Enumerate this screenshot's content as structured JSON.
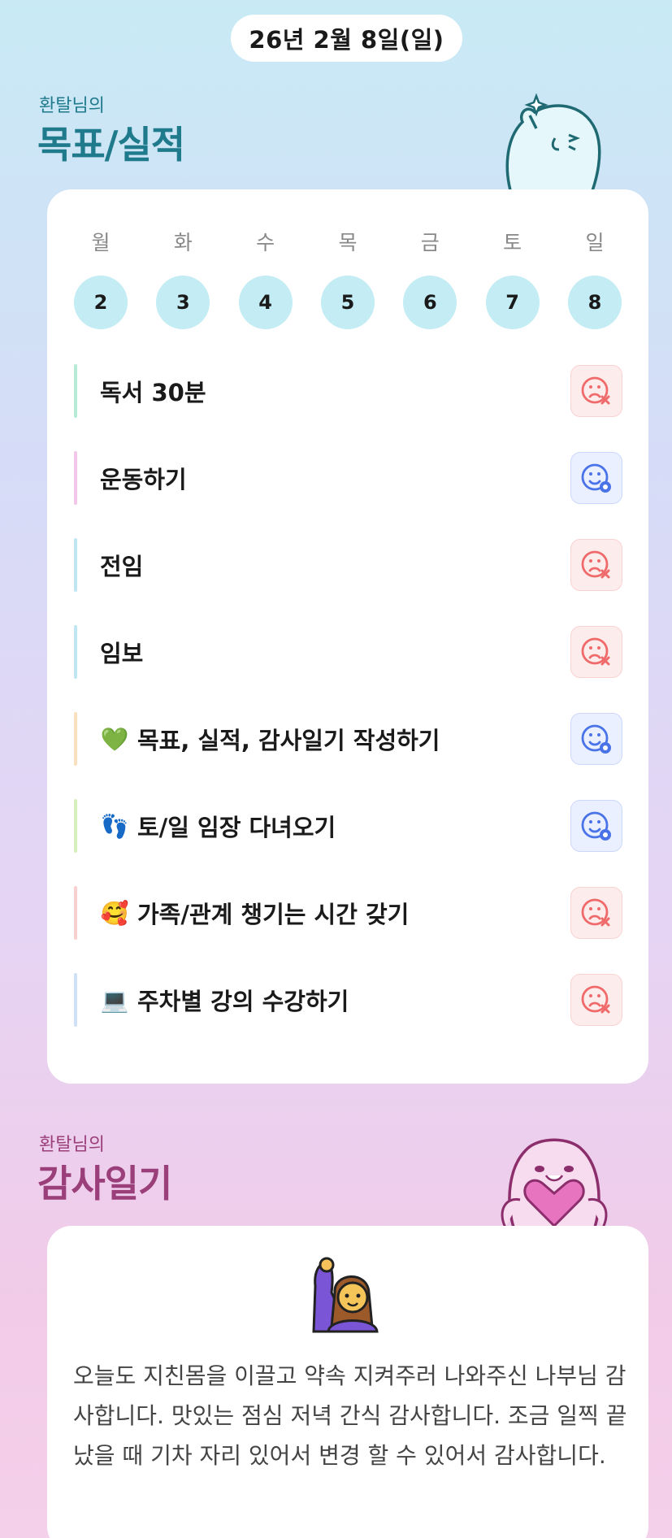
{
  "date": "26년 2월 8일(일)",
  "goals_section": {
    "owner": "환탈님의",
    "title": "목표/실적",
    "accent": "#1f7a8c"
  },
  "week": {
    "days": [
      {
        "dow": "월",
        "num": "2"
      },
      {
        "dow": "화",
        "num": "3"
      },
      {
        "dow": "수",
        "num": "4"
      },
      {
        "dow": "목",
        "num": "5"
      },
      {
        "dow": "금",
        "num": "6"
      },
      {
        "dow": "토",
        "num": "7"
      },
      {
        "dow": "일",
        "num": "8"
      }
    ]
  },
  "goals": [
    {
      "emoji": "",
      "label": "독서 30분",
      "status": "fail",
      "bar": "#b8ead8"
    },
    {
      "emoji": "",
      "label": "운동하기",
      "status": "done",
      "bar": "#f2c6e8"
    },
    {
      "emoji": "",
      "label": "전임",
      "status": "fail",
      "bar": "#bfe6f2"
    },
    {
      "emoji": "",
      "label": "임보",
      "status": "fail",
      "bar": "#bfe6f2"
    },
    {
      "emoji": "💚",
      "label": "목표, 실적, 감사일기 작성하기",
      "status": "done",
      "bar": "#fbe0bf"
    },
    {
      "emoji": "👣",
      "label": "토/일 임장 다녀오기",
      "status": "done",
      "bar": "#d6f0bd"
    },
    {
      "emoji": "🥰",
      "label": "가족/관계 챙기는 시간 갖기",
      "status": "fail",
      "bar": "#f9d0d0"
    },
    {
      "emoji": "💻",
      "label": "주차별 강의 수강하기",
      "status": "fail",
      "bar": "#cfe0f7"
    }
  ],
  "gratitude_section": {
    "owner": "환탈님의",
    "title": "감사일기",
    "accent": "#9b3f7a",
    "emoji": "raising-hand-woman-icon",
    "text": "오늘도 지친몸을 이끌고 약속 지켜주러 나와주신 나부님 감사합니다. 맛있는 점심 저녁 간식 감사합니다. 조금 일찍 끝났을 때 기차 자리 있어서 변경 할 수 있어서 감사합니다."
  },
  "colors": {
    "fail": "#ef6b6b",
    "done": "#4a73e8",
    "day_circle": "#c3ecf4"
  }
}
